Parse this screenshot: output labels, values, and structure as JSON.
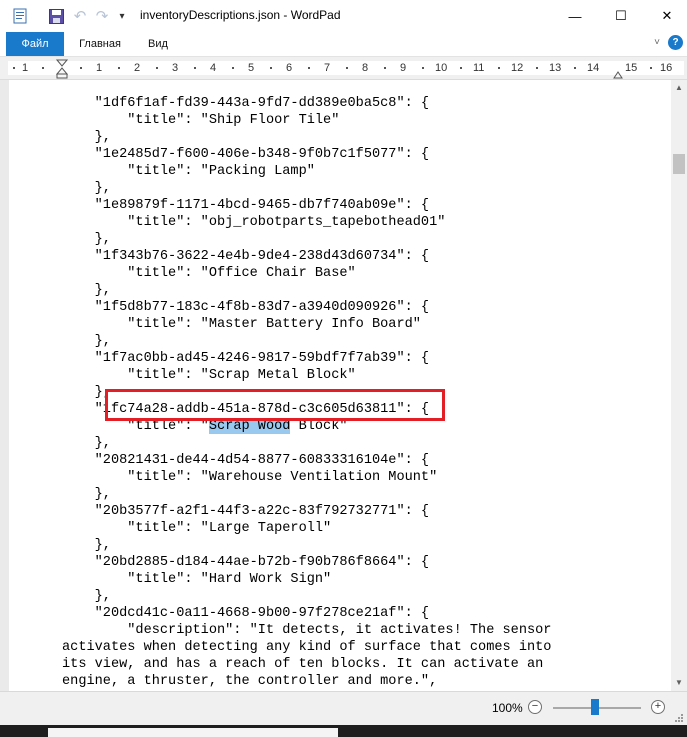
{
  "window": {
    "title": "inventoryDescriptions.json - WordPad",
    "controls": {
      "minimize": "—",
      "maximize": "☐",
      "close": "✕"
    }
  },
  "quick_access": {
    "icons": [
      "wordpad-app-icon",
      "save-icon",
      "undo-icon",
      "redo-icon",
      "customize-quick-access-icon"
    ]
  },
  "ribbon": {
    "tabs": [
      {
        "label": "Файл",
        "active": true
      },
      {
        "label": "Главная",
        "active": false
      },
      {
        "label": "Вид",
        "active": false
      }
    ],
    "collapse_glyph": "˅",
    "help_glyph": "?"
  },
  "ruler": {
    "numbers": [
      "1",
      "1",
      "2",
      "3",
      "4",
      "5",
      "6",
      "7",
      "8",
      "9",
      "10",
      "11",
      "12",
      "13",
      "14",
      "15",
      "16"
    ]
  },
  "document": {
    "lines": [
      "    \"1df6f1af-fd39-443a-9fd7-dd389e0ba5c8\": {",
      "        \"title\": \"Ship Floor Tile\"",
      "    },",
      "    \"1e2485d7-f600-406e-b348-9f0b7c1f5077\": {",
      "        \"title\": \"Packing Lamp\"",
      "    },",
      "    \"1e89879f-1171-4bcd-9465-db7f740ab09e\": {",
      "        \"title\": \"obj_robotparts_tapebothead01\"",
      "    },",
      "    \"1f343b76-3622-4e4b-9de4-238d43d60734\": {",
      "        \"title\": \"Office Chair Base\"",
      "    },",
      "    \"1f5d8b77-183c-4f8b-83d7-a3940d090926\": {",
      "        \"title\": \"Master Battery Info Board\"",
      "    },",
      "    \"1f7ac0bb-ad45-4246-9817-59bdf7f7ab39\": {",
      "        \"title\": \"Scrap Metal Block\"",
      "    },",
      "    \"1fc74a28-addb-451a-878d-c3c605d63811\": {",
      "        \"title\": \"",
      "    \"20821431-de44-4d54-8877-60833316104e\": {",
      "        \"title\": \"Warehouse Ventilation Mount\"",
      "    },",
      "    \"20b3577f-a2f1-44f3-a22c-83f792732771\": {",
      "        \"title\": \"Large Taperoll\"",
      "    },",
      "    \"20bd2885-d184-44ae-b72b-f90b786f8664\": {",
      "        \"title\": \"Hard Work Sign\"",
      "    },",
      "    \"20dcd41c-0a11-4668-9b00-97f278ce21af\": {",
      "        \"description\": \"It detects, it activates! The sensor",
      "activates when detecting any kind of surface that comes into",
      "its view, and has a reach of ten blocks. It can activate an",
      "engine, a thruster, the controller and more.\","
    ],
    "selected_text": "Scrap Wood",
    "after_selection": " Block\""
  },
  "statusbar": {
    "zoom": "100%",
    "zoom_level_percent": 100,
    "zoom_out": "−",
    "zoom_in": "+"
  }
}
